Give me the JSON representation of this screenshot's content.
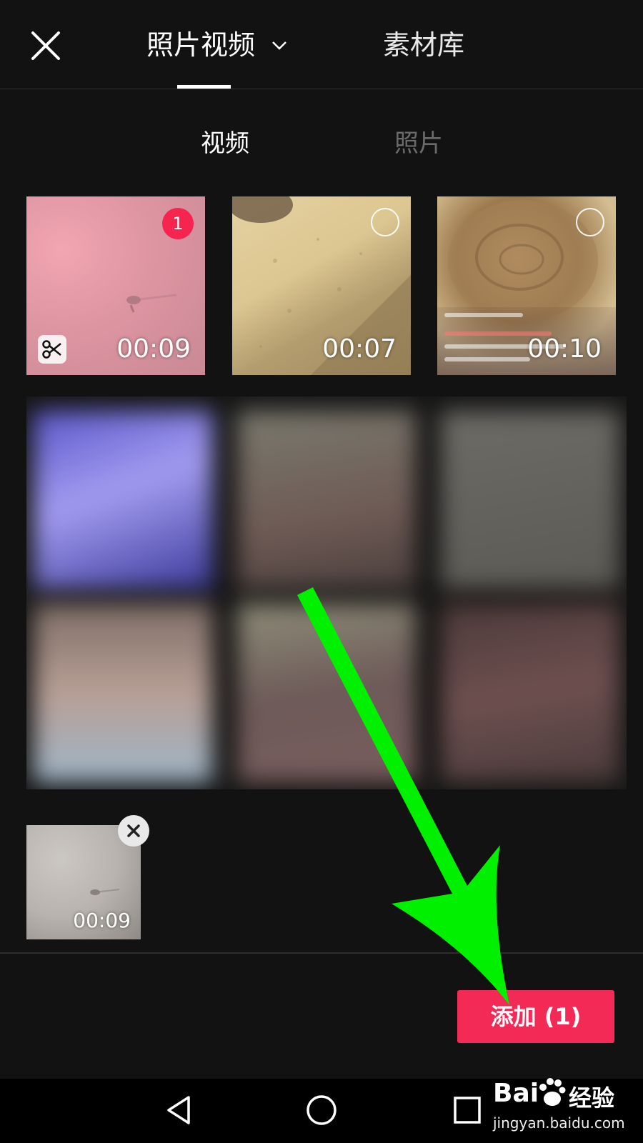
{
  "header": {
    "tabs": [
      {
        "label": "照片视频",
        "active": true,
        "has_dropdown": true
      },
      {
        "label": "素材库",
        "active": false
      }
    ],
    "close_icon": "close-icon"
  },
  "subtabs": [
    {
      "label": "视频",
      "active": true
    },
    {
      "label": "照片",
      "active": false
    }
  ],
  "thumbnails": [
    {
      "duration": "00:09",
      "selected": true,
      "selection_index": "1",
      "has_edit": true
    },
    {
      "duration": "00:07",
      "selected": false
    },
    {
      "duration": "00:10",
      "selected": false
    }
  ],
  "selected_tray": [
    {
      "duration": "00:09"
    }
  ],
  "footer": {
    "add_button": "添加 (1)"
  },
  "watermark": {
    "brand": "Bai",
    "brand_cn": "经验",
    "url": "jingyan.baidu.com"
  },
  "colors": {
    "accent": "#f32a55",
    "background": "#121212",
    "annotation_arrow": "#00ff00"
  }
}
